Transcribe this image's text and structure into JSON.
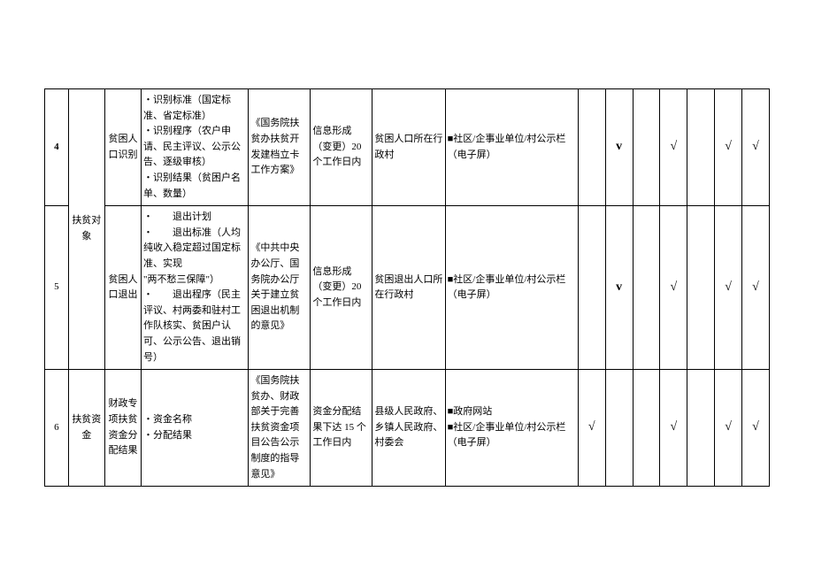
{
  "rows": [
    {
      "idx": "4",
      "category": "扶贫对象",
      "item": "贫困人口识别",
      "content": "・识别标准（国定标准、省定标准）\n・识别程序（农户申请、民主评议、公示公告、逐级审核）\n・识别结果（贫困户名单、数量）",
      "basis": "《国务院扶贫办扶贫开发建档立卡工作方案》",
      "limit": "信息形成（变更）20 个工作日内",
      "subject": "贫困人口所在行政村",
      "channel": "■社区/企事业单位/村公示栏（电子屏）",
      "checks": [
        "",
        "v",
        "",
        "√",
        "",
        "√",
        "√"
      ]
    },
    {
      "idx": "5",
      "item": "贫困人口退出",
      "content": "・　　退出计划\n・　　退出标准（人均纯收入稳定超过国定标准、实现\n\"两不愁三保障\"）\n・　　退出程序（民主评议、村两委和驻村工作队核实、贫困户认可、公示公告、退出销号）",
      "basis": "《中共中央办公厅、国务院办公厅关于建立贫困退出机制的意见》",
      "limit": "信息形成（变更）20 个工作日内",
      "subject": "贫困退出人口所在行政村",
      "channel": "■社区/企事业单位/村公示栏（电子屏）",
      "checks": [
        "",
        "v",
        "",
        "√",
        "",
        "√",
        "√"
      ]
    },
    {
      "idx": "6",
      "category": "扶贫资金",
      "item": "财政专项扶贫资金分配结果",
      "content": "・资金名称\n・分配结果",
      "basis": "《国务院扶贫办、财政部关于完善扶贫资金项目公告公示制度的指导意见》",
      "limit": "资金分配结果下达 15 个工作日内",
      "subject": "县级人民政府、乡镇人民政府、村委会",
      "channel": "■政府网站\n■社区/企事业单位/村公示栏（电子屏）",
      "checks": [
        "√",
        "",
        "",
        "√",
        "",
        "√",
        "√"
      ]
    }
  ]
}
